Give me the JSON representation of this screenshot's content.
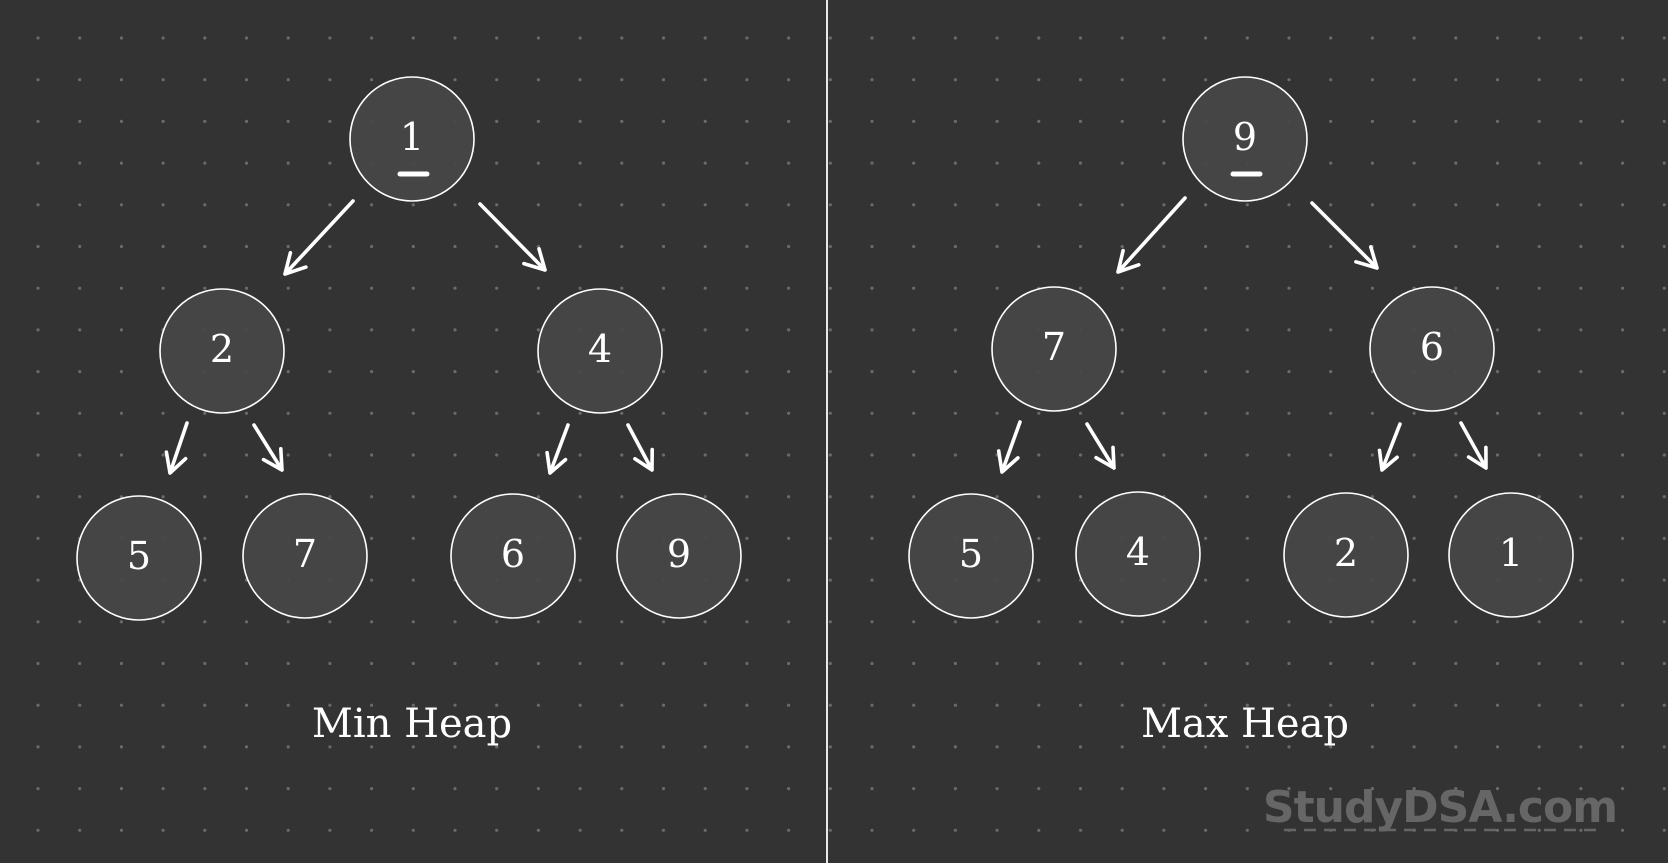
{
  "colors": {
    "background": "#333333",
    "node_fill": "#474747",
    "stroke": "#ffffff",
    "grid_dot": "#6a6a6a",
    "watermark": "#666666"
  },
  "panels": [
    {
      "id": "min",
      "title": "Min Heap",
      "root_index": 0,
      "nodes": [
        {
          "value": "1",
          "level": 0
        },
        {
          "value": "2",
          "level": 1
        },
        {
          "value": "4",
          "level": 1
        },
        {
          "value": "5",
          "level": 2
        },
        {
          "value": "7",
          "level": 2
        },
        {
          "value": "6",
          "level": 2
        },
        {
          "value": "9",
          "level": 2
        }
      ],
      "edges": [
        [
          0,
          1
        ],
        [
          0,
          2
        ],
        [
          1,
          3
        ],
        [
          1,
          4
        ],
        [
          2,
          5
        ],
        [
          2,
          6
        ]
      ]
    },
    {
      "id": "max",
      "title": "Max Heap",
      "root_index": 0,
      "nodes": [
        {
          "value": "9",
          "level": 0
        },
        {
          "value": "7",
          "level": 1
        },
        {
          "value": "6",
          "level": 1
        },
        {
          "value": "5",
          "level": 2
        },
        {
          "value": "4",
          "level": 2
        },
        {
          "value": "2",
          "level": 2
        },
        {
          "value": "1",
          "level": 2
        }
      ],
      "edges": [
        [
          0,
          1
        ],
        [
          0,
          2
        ],
        [
          1,
          3
        ],
        [
          1,
          4
        ],
        [
          2,
          5
        ],
        [
          2,
          6
        ]
      ]
    }
  ],
  "watermark": "StudyDSA.com"
}
